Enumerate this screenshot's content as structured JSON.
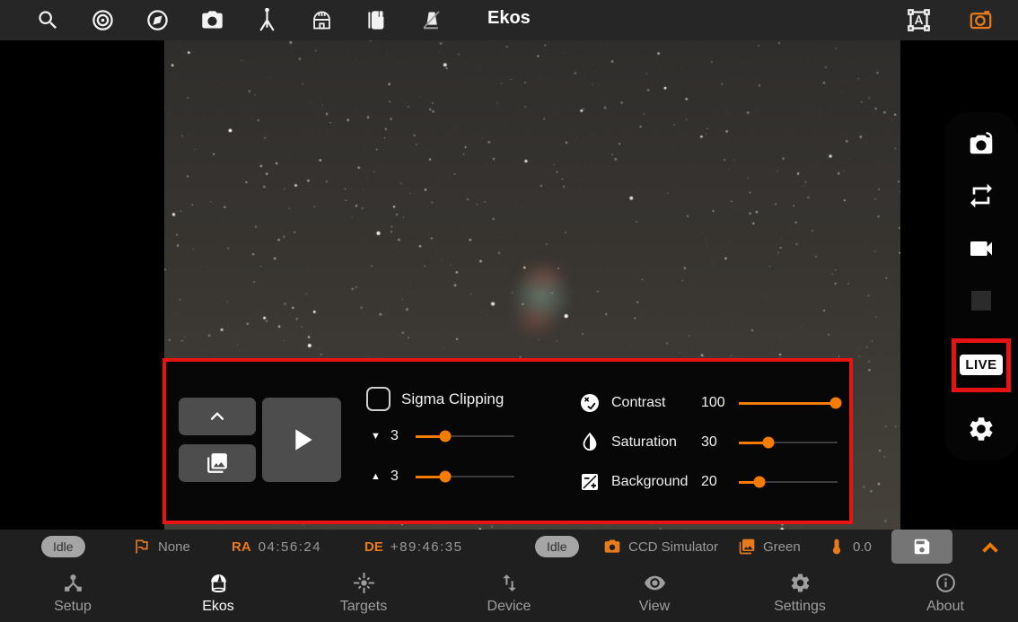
{
  "topbar": {
    "title": "Ekos",
    "left_icons": [
      "search-icon",
      "alignment-target-icon",
      "compass-icon",
      "capture-camera-icon",
      "mount-tripod-icon",
      "dome-icon",
      "dustcap-icon",
      "flat-panel-icon"
    ],
    "right_icons": [
      "format-shapes-icon",
      "camera-orange-icon"
    ]
  },
  "right_toolbar": {
    "icons": [
      "preview-camera-icon",
      "loop-icon",
      "video-icon",
      "stop-icon",
      "live-badge",
      "gear-icon"
    ],
    "live_label": "LIVE"
  },
  "overlay_panel": {
    "buttons": [
      "collapse-up-button",
      "gallery-button",
      "play-button"
    ],
    "sigma_clipping_label": "Sigma Clipping",
    "sigma_low": {
      "value": "3",
      "percent": "30%"
    },
    "sigma_high": {
      "value": "3",
      "percent": "30%"
    },
    "adjustments": [
      {
        "icon": "contrast-icon",
        "label": "Contrast",
        "value": "100",
        "percent": "98%"
      },
      {
        "icon": "saturation-icon",
        "label": "Saturation",
        "value": "30",
        "percent": "30%"
      },
      {
        "icon": "background-icon",
        "label": "Background",
        "value": "20",
        "percent": "21%"
      }
    ]
  },
  "status_bar": {
    "mount_status": "Idle",
    "target_value": "None",
    "ra_label": "RA",
    "ra_value": "04:56:24",
    "de_label": "DE",
    "de_value": "+89:46:35",
    "capture_status": "Idle",
    "camera_name": "CCD Simulator",
    "filter_name": "Green",
    "temperature": "0.0",
    "icons": [
      "flag-icon",
      "camera-icon",
      "photo-library-icon",
      "thermometer-icon",
      "save-icon",
      "chevron-up-icon"
    ]
  },
  "nav": {
    "items": [
      {
        "label": "Setup",
        "icon": "device-hub-icon",
        "active": false
      },
      {
        "label": "Ekos",
        "icon": "dome-icon",
        "active": true
      },
      {
        "label": "Targets",
        "icon": "flare-icon",
        "active": false
      },
      {
        "label": "Device",
        "icon": "swap-vert-icon",
        "active": false
      },
      {
        "label": "View",
        "icon": "eye-icon",
        "active": false
      },
      {
        "label": "Settings",
        "icon": "gear-icon",
        "active": false
      },
      {
        "label": "About",
        "icon": "info-icon",
        "active": false
      }
    ]
  },
  "colors": {
    "accent_orange": "#e87a1e",
    "slider_orange": "#f57c00",
    "annotation_red": "#e81414",
    "topbar_bg": "#262626",
    "bar_bg": "#1f1f1f"
  }
}
